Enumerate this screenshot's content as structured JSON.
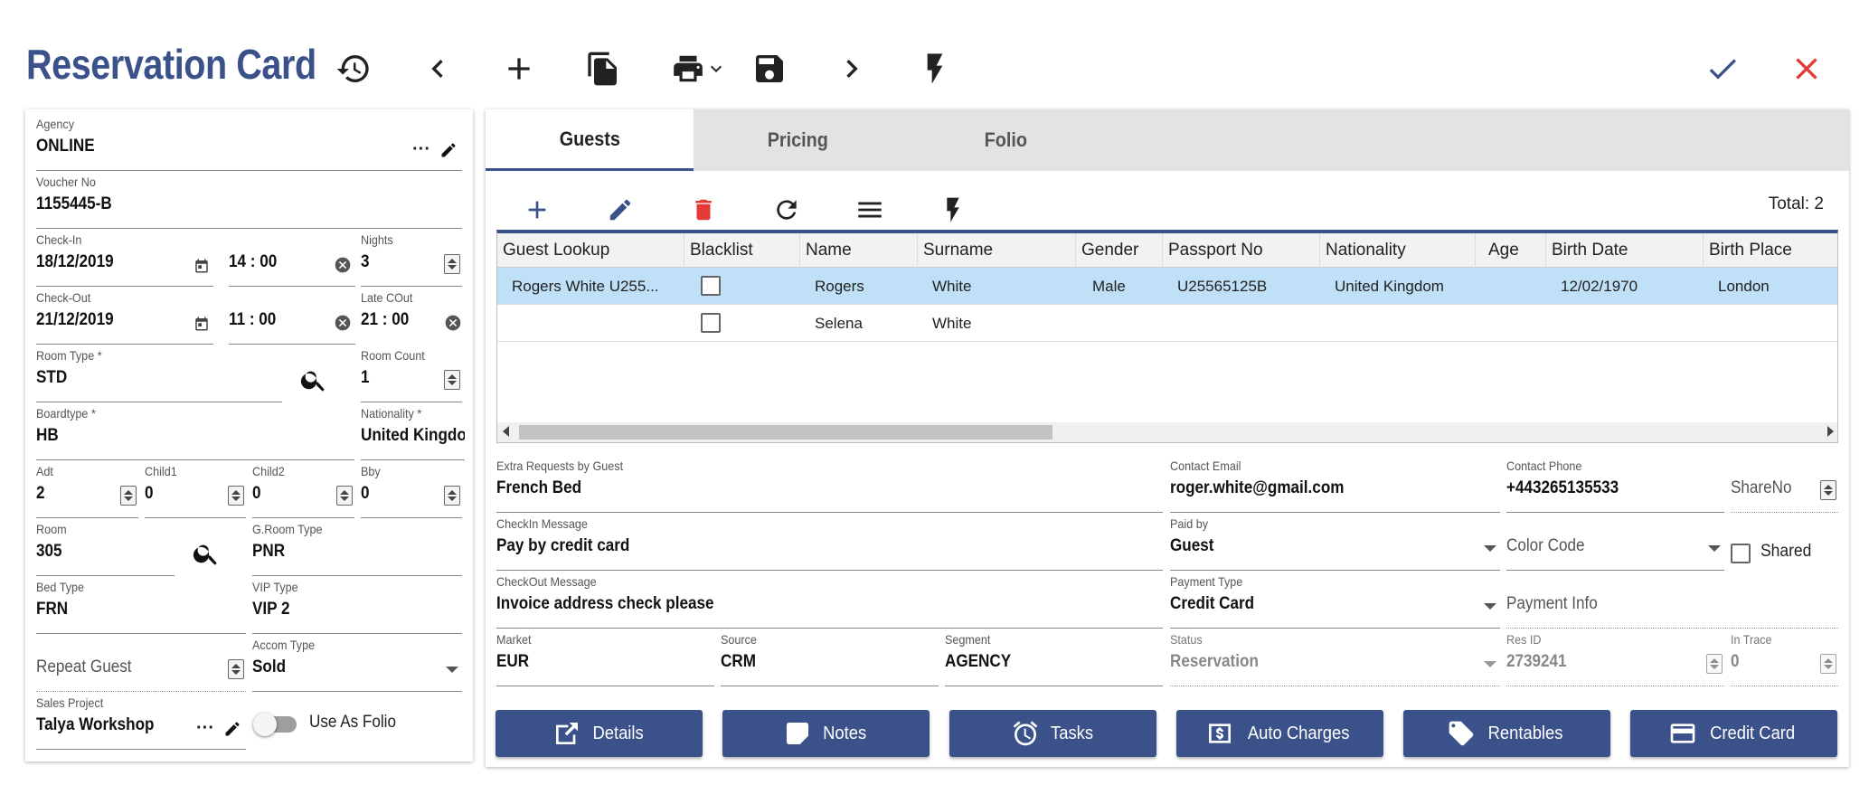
{
  "header": {
    "title": "Reservation Card",
    "accent": "#3a5189",
    "icons": [
      "history-icon",
      "chevron-left-icon",
      "plus-icon",
      "copy-icon",
      "print-icon",
      "save-icon",
      "chevron-right-icon",
      "bolt-icon",
      "check-icon",
      "close-icon"
    ]
  },
  "left": {
    "agency": {
      "label": "Agency",
      "value": "ONLINE"
    },
    "voucher": {
      "label": "Voucher No",
      "value": "1155445-B"
    },
    "checkin": {
      "label": "Check-In",
      "date": "18/12/2019",
      "time": "14 : 00"
    },
    "nights": {
      "label": "Nights",
      "value": "3"
    },
    "checkout": {
      "label": "Check-Out",
      "date": "21/12/2019",
      "time": "11 : 00"
    },
    "latecout": {
      "label": "Late COut",
      "value": "21 : 00"
    },
    "roomtype": {
      "label": "Room Type *",
      "value": "STD"
    },
    "roomcount": {
      "label": "Room Count",
      "value": "1"
    },
    "boardtype": {
      "label": "Boardtype *",
      "value": "HB"
    },
    "nationality": {
      "label": "Nationality *",
      "value": "United Kingdom"
    },
    "adt": {
      "label": "Adt",
      "value": "2"
    },
    "child1": {
      "label": "Child1",
      "value": "0"
    },
    "child2": {
      "label": "Child2",
      "value": "0"
    },
    "bby": {
      "label": "Bby",
      "value": "0"
    },
    "room": {
      "label": "Room",
      "value": "305"
    },
    "groomtype": {
      "label": "G.Room Type",
      "value": "PNR"
    },
    "bedtype": {
      "label": "Bed Type",
      "value": "FRN"
    },
    "viptype": {
      "label": "VIP Type",
      "value": "VIP 2"
    },
    "repeatguest": {
      "placeholder": "Repeat Guest"
    },
    "accomtype": {
      "label": "Accom Type",
      "value": "Sold"
    },
    "salesproject": {
      "label": "Sales Project",
      "value": "Talya Workshop"
    },
    "useasfolio": {
      "label": "Use As Folio"
    }
  },
  "tabs": [
    {
      "label": "Guests"
    },
    {
      "label": "Pricing"
    },
    {
      "label": "Folio"
    }
  ],
  "guests": {
    "total": "Total: 2",
    "columns": [
      "Guest Lookup",
      "Blacklist",
      "Name",
      "Surname",
      "Gender",
      "Passport No",
      "Nationality",
      "Age",
      "Birth Date",
      "Birth Place"
    ],
    "rows": [
      {
        "lookup": "Rogers White U255...",
        "name": "Rogers",
        "surname": "White",
        "gender": "Male",
        "passport": "U25565125B",
        "nationality": "United Kingdom",
        "age": "",
        "birthdate": "12/02/1970",
        "birthplace": "London"
      },
      {
        "lookup": "",
        "name": "Selena",
        "surname": "White",
        "gender": "",
        "passport": "",
        "nationality": "",
        "age": "",
        "birthdate": "",
        "birthplace": ""
      }
    ]
  },
  "details": {
    "extra": {
      "label": "Extra Requests by Guest",
      "value": "French Bed"
    },
    "email": {
      "label": "Contact Email",
      "value": "roger.white@gmail.com"
    },
    "phone": {
      "label": "Contact Phone",
      "value": "+443265135533"
    },
    "shareno": {
      "placeholder": "ShareNo"
    },
    "checkinmsg": {
      "label": "CheckIn Message",
      "value": "Pay by credit card"
    },
    "paidby": {
      "label": "Paid by",
      "value": "Guest"
    },
    "colorcode": {
      "placeholder": "Color Code"
    },
    "shared": {
      "label": "Shared"
    },
    "checkoutmsg": {
      "label": "CheckOut Message",
      "value": "Invoice address check please"
    },
    "paymenttype": {
      "label": "Payment Type",
      "value": "Credit Card"
    },
    "paymentinfo": {
      "placeholder": "Payment Info"
    },
    "market": {
      "label": "Market",
      "value": "EUR"
    },
    "source": {
      "label": "Source",
      "value": "CRM"
    },
    "segment": {
      "label": "Segment",
      "value": "AGENCY"
    },
    "status": {
      "label": "Status",
      "value": "Reservation"
    },
    "resid": {
      "label": "Res ID",
      "value": "2739241"
    },
    "intrace": {
      "label": "In Trace",
      "value": "0"
    }
  },
  "buttons": [
    {
      "label": "Details",
      "icon": "share-icon"
    },
    {
      "label": "Notes",
      "icon": "note-icon"
    },
    {
      "label": "Tasks",
      "icon": "alarm-icon"
    },
    {
      "label": "Auto Charges",
      "icon": "dollar-icon"
    },
    {
      "label": "Rentables",
      "icon": "tag-icon"
    },
    {
      "label": "Credit Card",
      "icon": "credit-card-icon"
    }
  ]
}
